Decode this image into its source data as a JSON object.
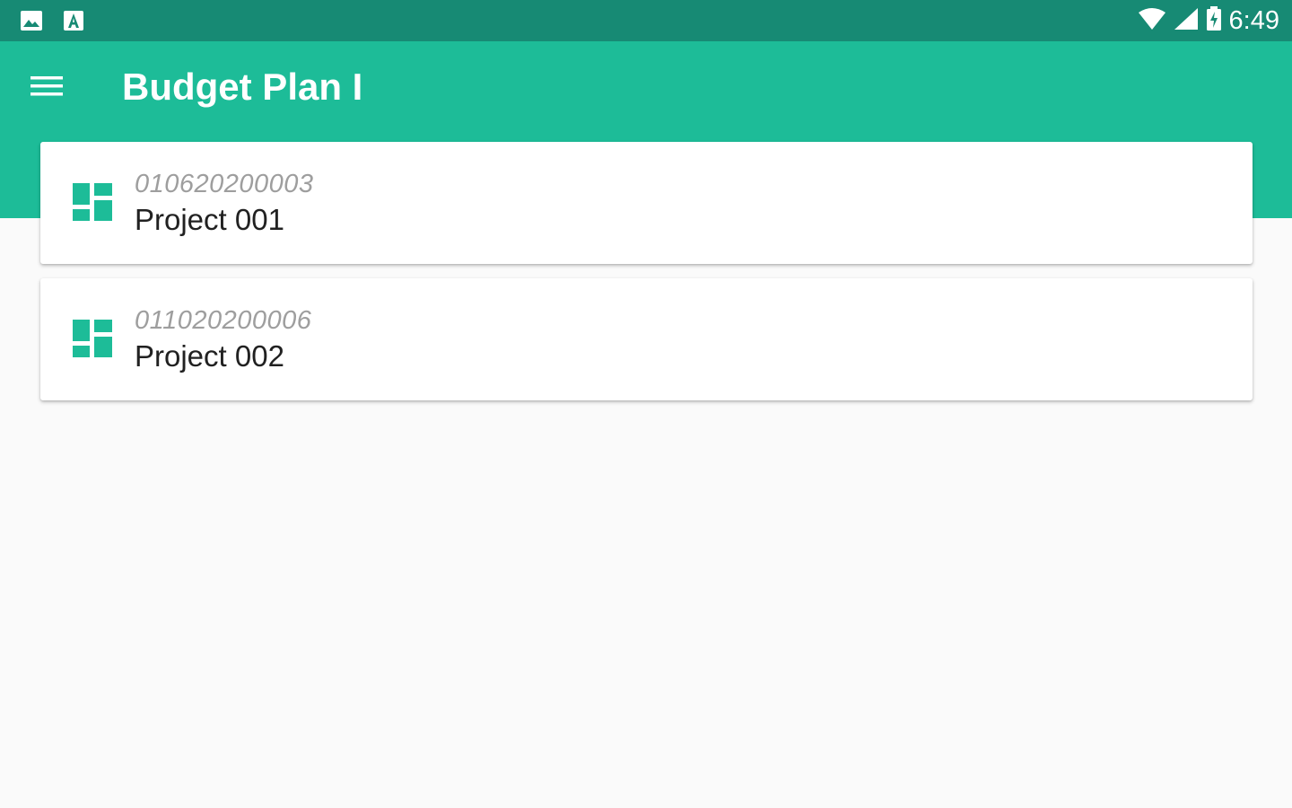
{
  "status_bar": {
    "left_icons": [
      "image-icon",
      "font-icon"
    ],
    "right_icons": [
      "wifi-icon",
      "signal-icon",
      "battery-charging-icon"
    ],
    "time": "6:49"
  },
  "app_bar": {
    "menu_icon": "hamburger-menu-icon",
    "title": "Budget Plan I"
  },
  "projects": [
    {
      "code": "010620200003",
      "name": "Project 001",
      "icon": "dashboard-icon"
    },
    {
      "code": "011020200006",
      "name": "Project 002",
      "icon": "dashboard-icon"
    }
  ],
  "colors": {
    "status_bar": "#178a74",
    "app_bar": "#1dbc98",
    "accent_icon": "#1dbc98",
    "background": "#fafafa"
  }
}
